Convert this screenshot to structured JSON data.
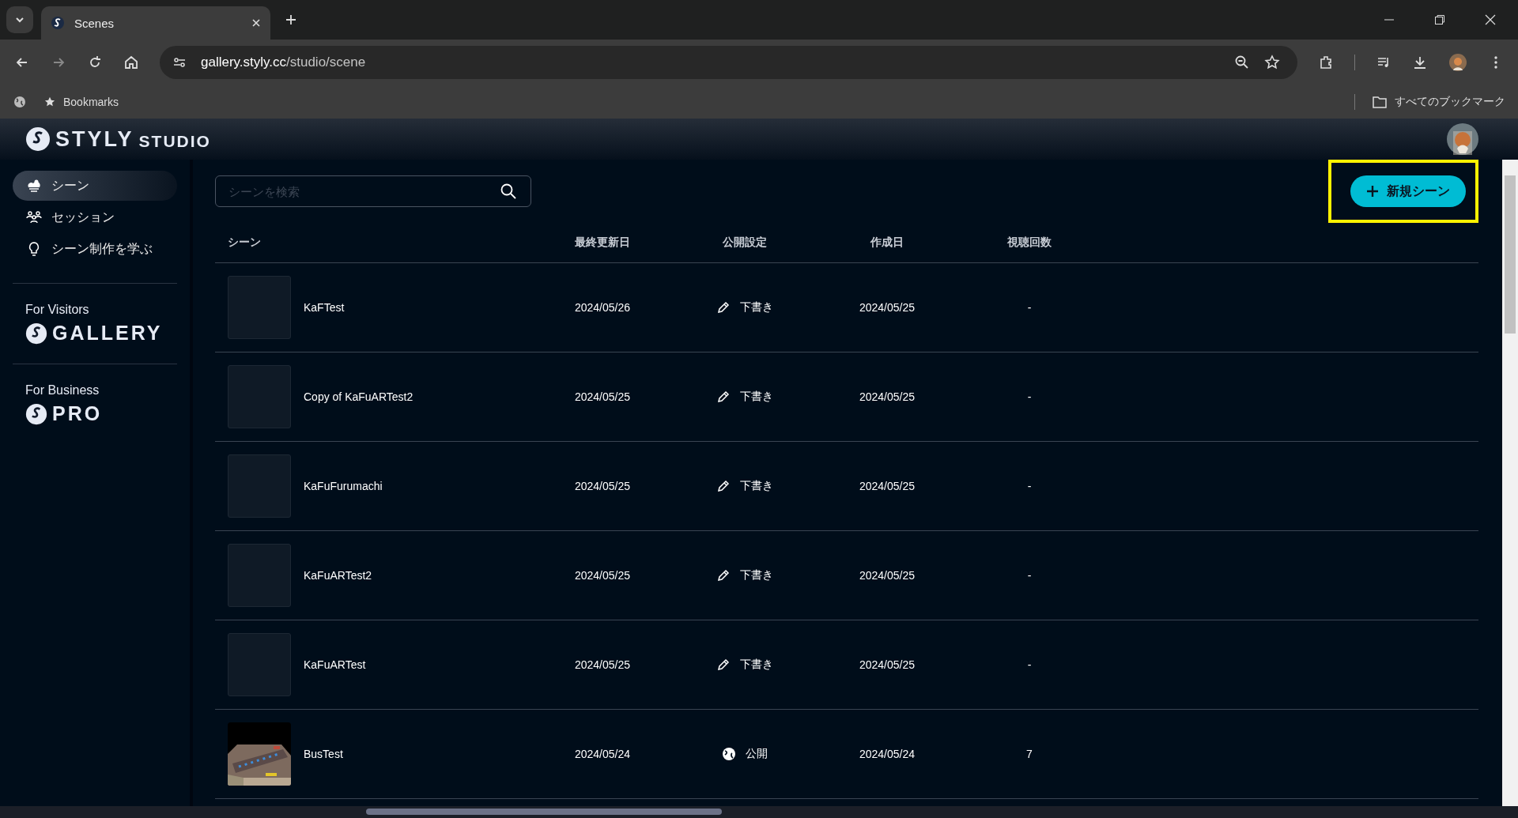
{
  "browser": {
    "tab_title": "Scenes",
    "url_host": "gallery.styly.cc",
    "url_path": "/studio/scene",
    "bookmarks_label": "Bookmarks",
    "all_bookmarks": "すべてのブックマーク"
  },
  "header": {
    "logo_main": "STYLY",
    "logo_sub": "STUDIO"
  },
  "sidebar": {
    "items": [
      {
        "label": "シーン",
        "selected": true,
        "kind": "scene"
      },
      {
        "label": "セッション",
        "selected": false,
        "kind": "session"
      },
      {
        "label": "シーン制作を学ぶ",
        "selected": false,
        "kind": "learn"
      }
    ],
    "sections": [
      {
        "caption": "For Visitors",
        "brand": "GALLERY"
      },
      {
        "caption": "For Business",
        "brand": "PRO"
      }
    ]
  },
  "search": {
    "placeholder": "シーンを検索"
  },
  "new_button": {
    "label": "新規シーン",
    "highlighted": true
  },
  "table": {
    "columns": [
      "シーン",
      "最終更新日",
      "公開設定",
      "作成日",
      "視聴回数"
    ],
    "rows": [
      {
        "name": "KaFTest",
        "updated": "2024/05/26",
        "status": {
          "label": "下書き",
          "kind": "draft"
        },
        "created": "2024/05/25",
        "views": "-"
      },
      {
        "name": "Copy of KaFuARTest2",
        "updated": "2024/05/25",
        "status": {
          "label": "下書き",
          "kind": "draft"
        },
        "created": "2024/05/25",
        "views": "-"
      },
      {
        "name": "KaFuFurumachi",
        "updated": "2024/05/25",
        "status": {
          "label": "下書き",
          "kind": "draft"
        },
        "created": "2024/05/25",
        "views": "-"
      },
      {
        "name": "KaFuARTest2",
        "updated": "2024/05/25",
        "status": {
          "label": "下書き",
          "kind": "draft"
        },
        "created": "2024/05/25",
        "views": "-"
      },
      {
        "name": "KaFuARTest",
        "updated": "2024/05/25",
        "status": {
          "label": "下書き",
          "kind": "draft"
        },
        "created": "2024/05/25",
        "views": "-"
      },
      {
        "name": "BusTest",
        "updated": "2024/05/24",
        "status": {
          "label": "公開",
          "kind": "public"
        },
        "created": "2024/05/24",
        "views": "7"
      }
    ]
  }
}
